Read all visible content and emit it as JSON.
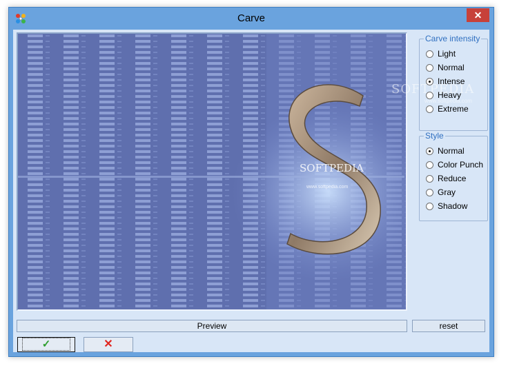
{
  "window": {
    "title": "Carve",
    "close_glyph": "✕",
    "app_icon": "paint-palette-icon"
  },
  "preview_image": {
    "watermark": "SOFTPEDIA",
    "watermark_sub": "www.softpedia.com",
    "logo_text": "SOFTPEDIA",
    "logo_url": "www.softpedia.com"
  },
  "carve_intensity": {
    "legend": "Carve intensity",
    "options": [
      "Light",
      "Normal",
      "Intense",
      "Heavy",
      "Extreme"
    ],
    "selected": "Intense"
  },
  "style": {
    "legend": "Style",
    "options": [
      "Normal",
      "Color Punch",
      "Reduce",
      "Gray",
      "Shadow"
    ],
    "selected": "Normal"
  },
  "buttons": {
    "preview": "Preview",
    "reset": "reset",
    "ok_glyph": "✓",
    "cancel_glyph": "✕"
  },
  "colors": {
    "accent_text": "#2f6fc0",
    "ok_check": "#2e9e2e",
    "cancel_x": "#e0261f",
    "close_button": "#c7413a"
  }
}
